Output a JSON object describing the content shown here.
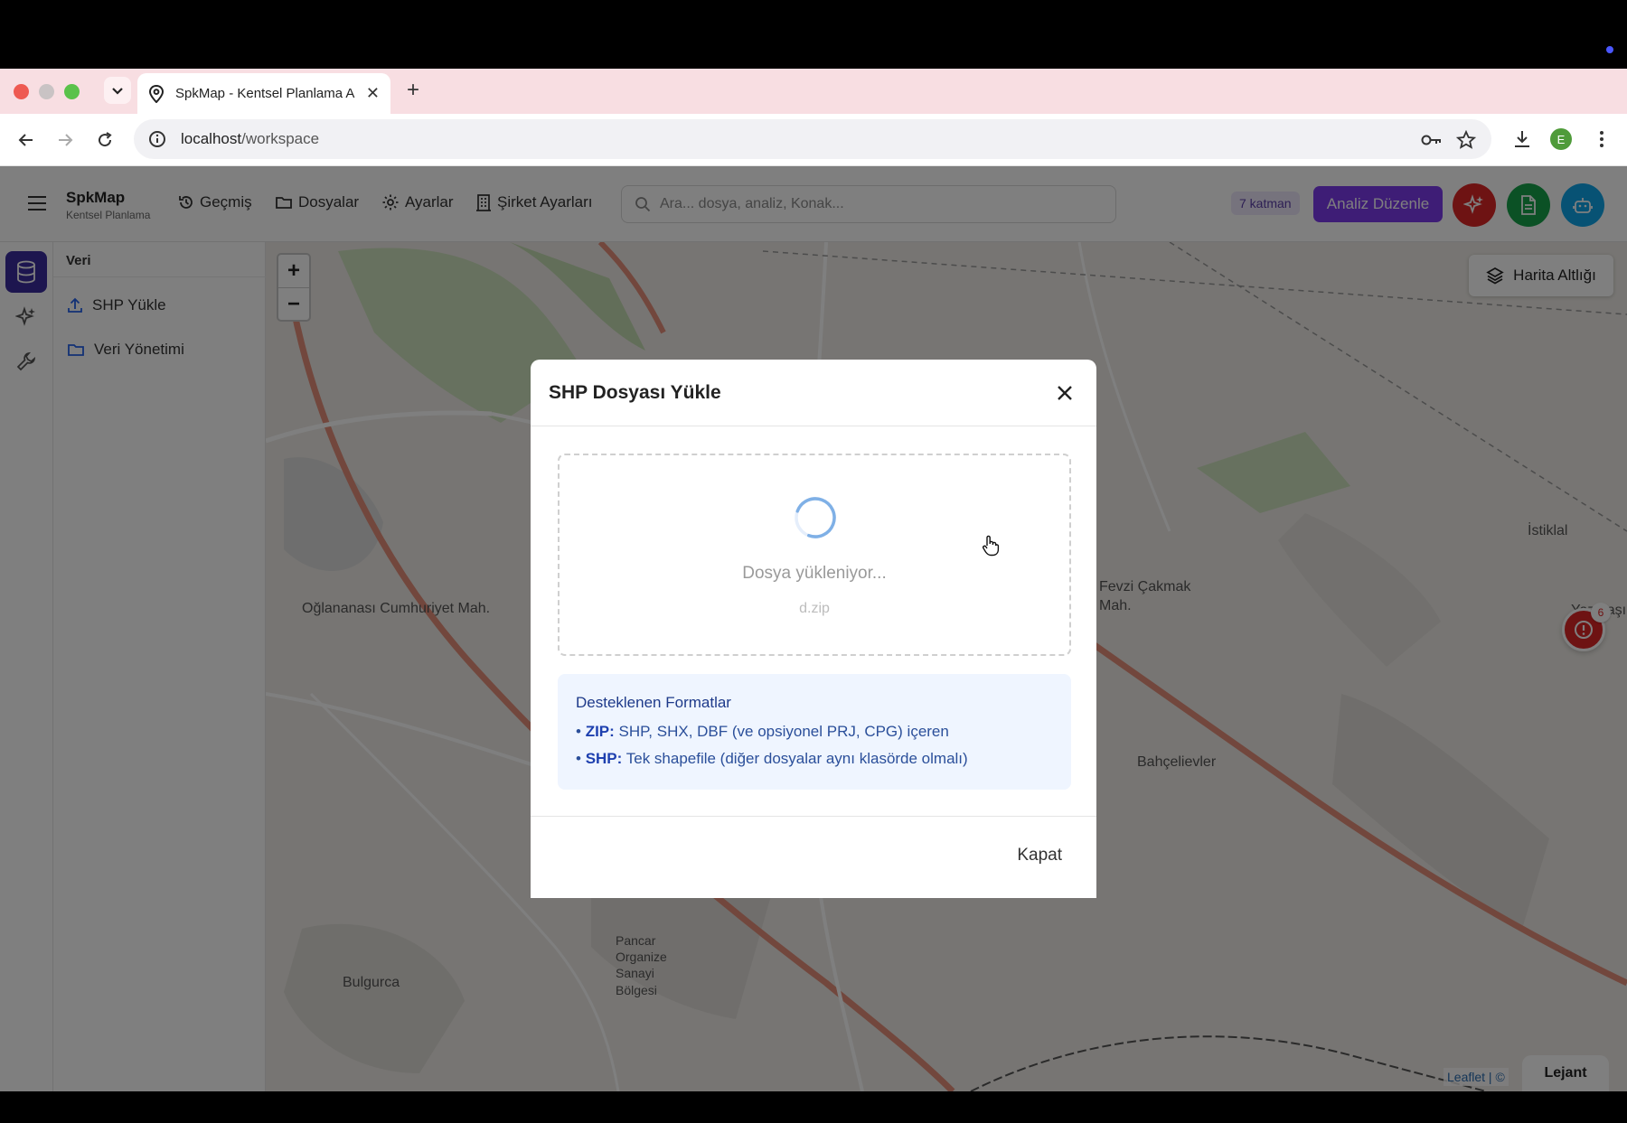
{
  "browser": {
    "tab_title": "SpkMap - Kentsel Planlama A",
    "url_host": "localhost",
    "url_path": "/workspace",
    "profile_initial": "E"
  },
  "app": {
    "brand_name": "SpkMap",
    "brand_sub": "Kentsel Planlama",
    "nav": [
      {
        "label": "Geçmiş",
        "icon": "history-icon"
      },
      {
        "label": "Dosyalar",
        "icon": "folder-icon"
      },
      {
        "label": "Ayarlar",
        "icon": "gear-icon"
      },
      {
        "label": "Şirket Ayarları",
        "icon": "building-icon"
      }
    ],
    "search_placeholder": "Ara... dosya, analiz, Konak...",
    "layer_count": "7 katman",
    "analiz_label": "Analiz Düzenle",
    "colors": {
      "accent": "#7c3aed",
      "rail_active": "#3b2d9e",
      "red": "#dc2626",
      "green": "#16a34a",
      "blue": "#0ea5e9"
    }
  },
  "sidebar": {
    "title": "Veri",
    "items": [
      {
        "label": "SHP Yükle",
        "icon": "upload-icon"
      },
      {
        "label": "Veri Yönetimi",
        "icon": "folder-icon"
      }
    ]
  },
  "map": {
    "zoom_in": "+",
    "zoom_out": "−",
    "basemap_label": "Harita Altlığı",
    "alert_count": "6",
    "legend_label": "Lejant",
    "attribution": "Leaflet | ©",
    "place_labels": [
      "Oğlananası Cumhuriyet Mah.",
      "Fevzi Çakmak Mah.",
      "Bahçelievler",
      "İstiklal",
      "Yazıbaşı",
      "Pancar Organize Sanayi Bölgesi",
      "Bulgurca"
    ]
  },
  "modal": {
    "title": "SHP Dosyası Yükle",
    "status": "Dosya yükleniyor...",
    "filename": "d.zip",
    "formats_title": "Desteklenen Formatlar",
    "formats": [
      {
        "name": "ZIP:",
        "desc": "SHP, SHX, DBF (ve opsiyonel PRJ, CPG) içeren"
      },
      {
        "name": "SHP:",
        "desc": "Tek shapefile (diğer dosyalar aynı klasörde olmalı)"
      }
    ],
    "close_label": "Kapat"
  }
}
